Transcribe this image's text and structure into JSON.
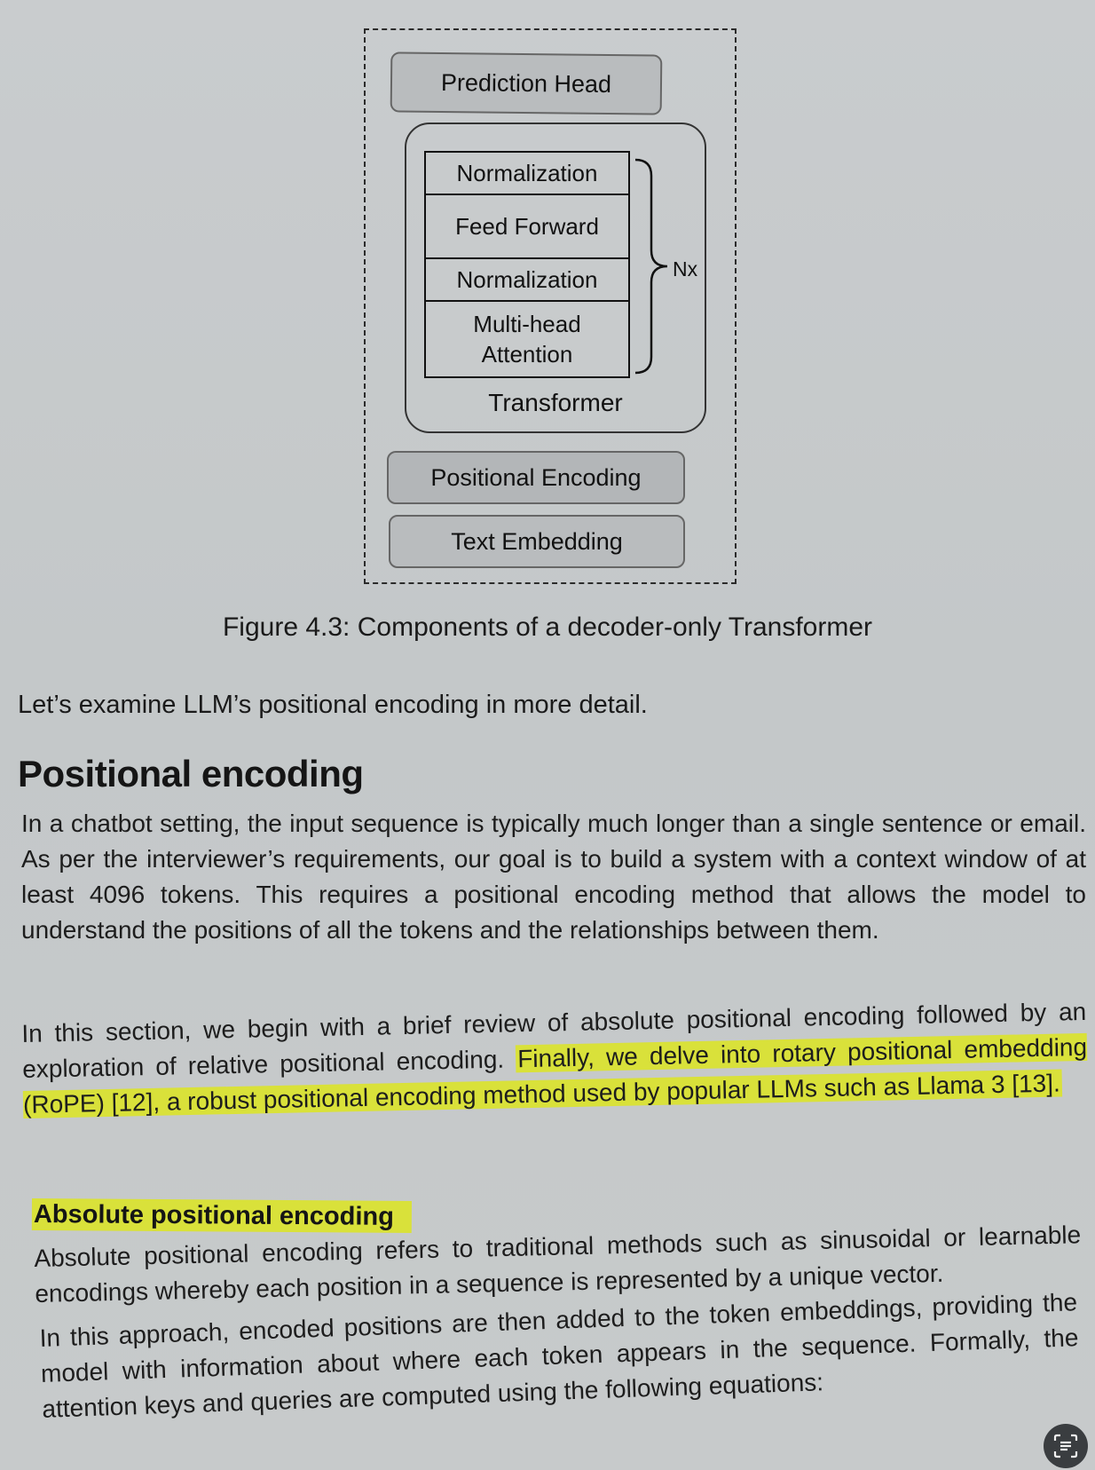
{
  "diagram": {
    "prediction_head": "Prediction Head",
    "layers": [
      "Normalization",
      "Feed Forward",
      "Normalization",
      "Multi-head\nAttention"
    ],
    "repeat_label": "Nx",
    "transformer_label": "Transformer",
    "positional_encoding": "Positional Encoding",
    "text_embedding": "Text Embedding"
  },
  "caption": "Figure 4.3: Components of a decoder-only Transformer",
  "intro": "Let’s examine LLM’s positional encoding in more detail.",
  "section_title": "Positional encoding",
  "para1": "In a chatbot setting, the input sequence is typically much longer than a single sentence or email. As per the interviewer’s requirements, our goal is to build a system with a context window of at least 4096 tokens. This requires a positional encoding method that allows the model to understand the positions of all the tokens and the relationships between them.",
  "para2_plain": "In this section, we begin with a brief review of absolute positional encoding followed by an exploration of relative positional encoding. ",
  "para2_highlight": "Finally, we delve into rotary positional embedding (RoPE) [12], a robust positional encoding method used by popular LLMs such as Llama 3 [13].",
  "subsection_title": "Absolute positional encoding",
  "para3": "Absolute positional encoding refers to traditional methods such as sinusoidal or learnable encodings whereby each position in a sequence is represented by a unique vector.",
  "para4": "In this approach, encoded positions are then added to the token embeddings, providing the model with information about where each token appears in the sequence. Formally, the attention keys and queries are computed using the following equations:",
  "icons": {
    "scan": "text-scan-icon"
  },
  "colors": {
    "highlight": "#d9e13a",
    "page": "#c8cbcc"
  }
}
